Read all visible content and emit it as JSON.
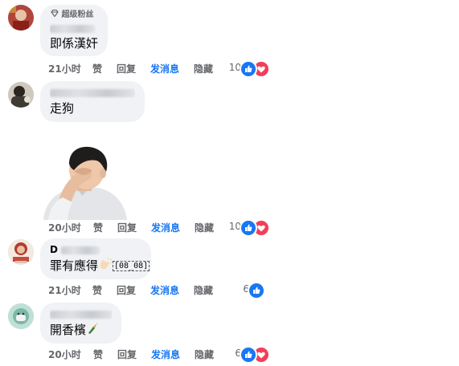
{
  "comments": [
    {
      "badge": "超级粉丝",
      "text": "即係漢奸",
      "actions": {
        "time": "21小时",
        "like": "赞",
        "reply": "回复",
        "send": "发消息",
        "hide": "隐藏"
      },
      "reactions": {
        "count": "10",
        "types": [
          "like-icon",
          "love-icon"
        ]
      },
      "colors": {
        "avatar": "#b0463a"
      }
    },
    {
      "text": "走狗",
      "actions": {
        "time": "20小时",
        "like": "赞",
        "reply": "回复",
        "send": "发消息",
        "hide": "隐藏"
      },
      "reactions": {
        "count": "10",
        "types": [
          "like-icon",
          "love-icon"
        ]
      },
      "sticker": "person-facepalm-sticker",
      "colors": {
        "avatar": "#3e3a34"
      }
    },
    {
      "author_visible": "D",
      "text": "罪有應得",
      "text_suffix": "[08_08]",
      "actions": {
        "time": "21小时",
        "like": "赞",
        "reply": "回复",
        "send": "发消息",
        "hide": "隐藏"
      },
      "reactions": {
        "count": "6",
        "types": [
          "like-icon"
        ]
      },
      "colors": {
        "avatar": "#d9c7b8"
      }
    },
    {
      "text": "開香檳",
      "actions": {
        "time": "20小时",
        "like": "赞",
        "reply": "回复",
        "send": "发消息",
        "hide": "隐藏"
      },
      "reactions": {
        "count": "6",
        "types": [
          "like-icon",
          "love-icon"
        ]
      },
      "colors": {
        "avatar": "#7cb8a8"
      }
    }
  ],
  "colors": {
    "like": "#1877f2",
    "love": "#f33e58",
    "send_link": "#1877f2",
    "bubble": "#f0f2f5",
    "meta_text": "#65676b"
  }
}
